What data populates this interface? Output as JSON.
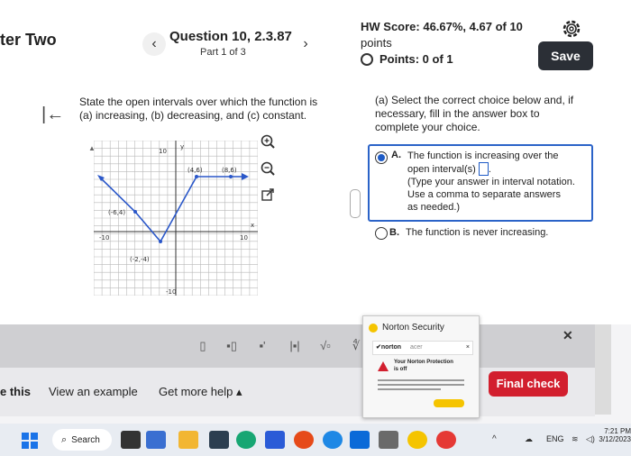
{
  "header": {
    "chapter_label": "ter Two",
    "question_title": "Question 10, 2.3.87",
    "part_label": "Part 1 of 3",
    "prev_arrow": "‹",
    "next_arrow": "›",
    "hw_score": "HW Score: 46.67%, 4.67 of 10",
    "hw_score_cont": "points",
    "points": "Points: 0 of 1",
    "save_label": "Save"
  },
  "question": {
    "back_glyph": "|←",
    "prompt": "State the open intervals over which the function is (a) increasing, (b) decreasing, and (c) constant."
  },
  "graph": {
    "label_y": "y",
    "label_x": "x",
    "top_tick": "10",
    "bottom_tick": "-10",
    "left_tick": "-10",
    "right_tick": "10",
    "point_a": "(4,6)",
    "point_b": "(8,6)",
    "point_c": "(-6,4)",
    "point_d": "(-2,-4)"
  },
  "answer": {
    "instructions": "(a) Select the correct choice below and, if necessary, fill in the answer box to complete your choice.",
    "choice_a_letter": "A.",
    "choice_a_line1": "The function is increasing over the",
    "choice_a_line2": "open interval(s)",
    "choice_a_hint1": "(Type your answer in interval notation.",
    "choice_a_hint2": "Use a comma to separate answers",
    "choice_a_hint3": "as needed.)",
    "choice_b_letter": "B.",
    "choice_b_text": "The function is never increasing."
  },
  "norton": {
    "title": "Norton Security",
    "close": "×",
    "tab_label": "✔norton",
    "tab_label2": "acer",
    "alert_title1": "Your Norton Protection",
    "alert_title2": "is off"
  },
  "bottom": {
    "left_cut": "e this",
    "view_example": "View an example",
    "get_help": "Get more help ▴",
    "final_check": "Final check",
    "close_x": "✕"
  },
  "taskbar": {
    "search_label": "Search",
    "lang": "ENG",
    "time": "7:21 PM",
    "date": "3/12/2023"
  },
  "colors": {
    "accent_blue": "#1e5bc6",
    "save_dark": "#2b2f36",
    "final_check_red": "#d21f2e",
    "graph_blue": "#2a57c9"
  }
}
